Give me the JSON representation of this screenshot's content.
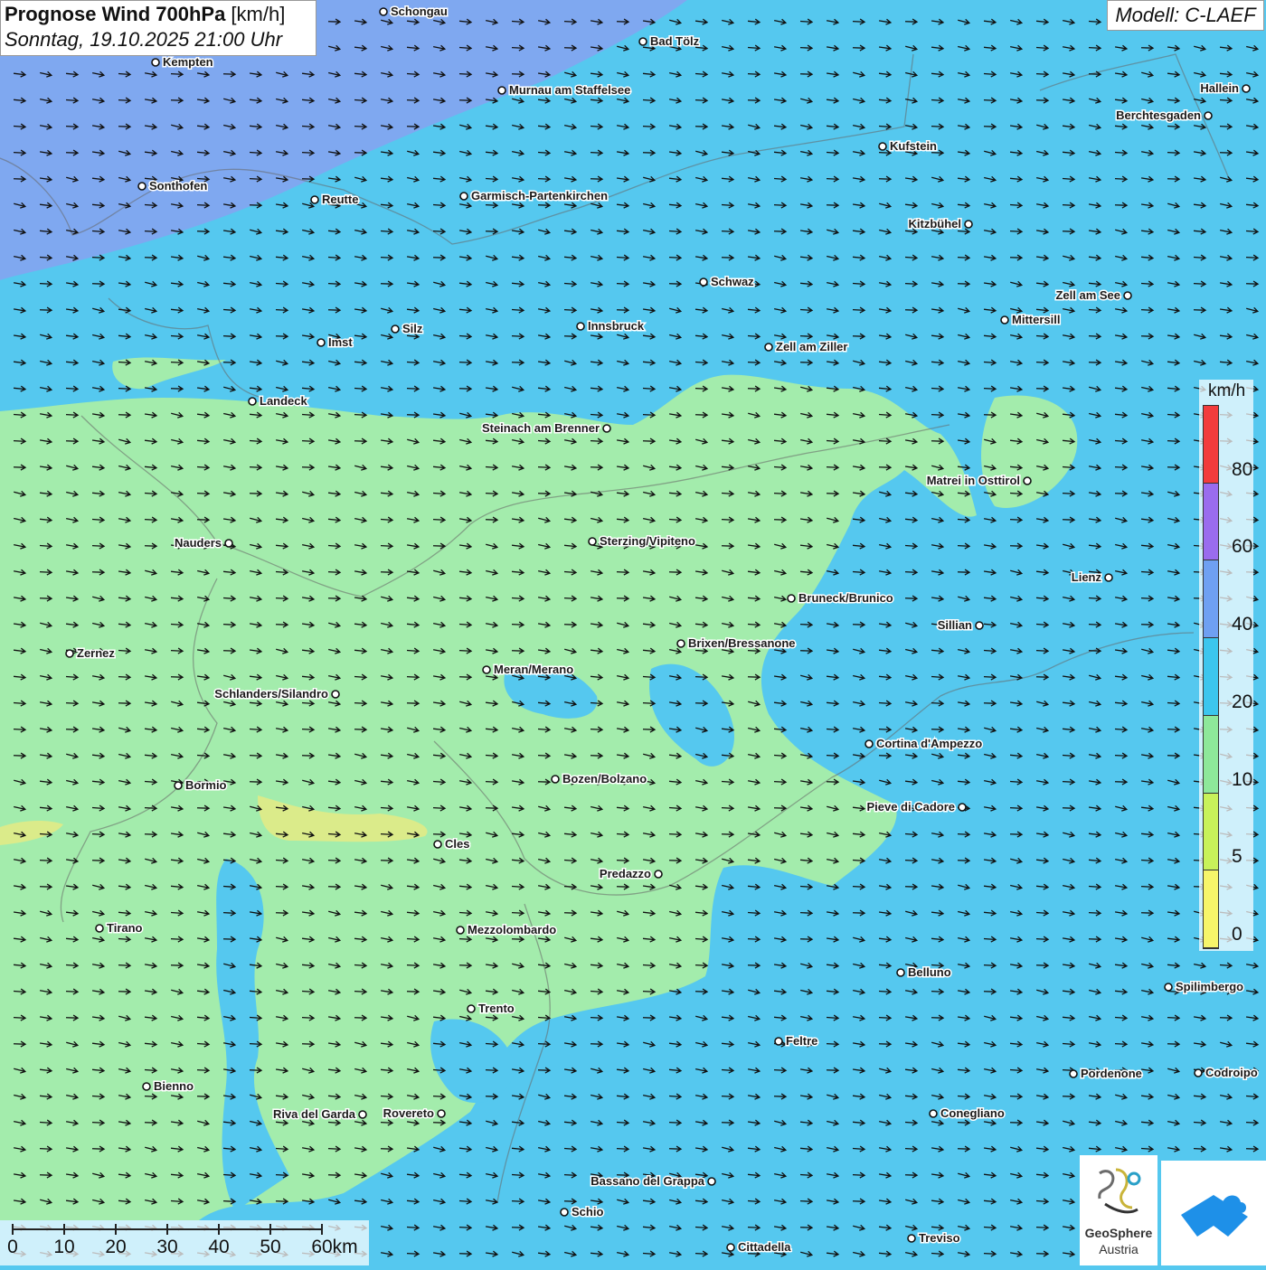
{
  "title": {
    "main_bold": "Prognose Wind 700hPa",
    "main_unit": " [km/h]",
    "subtitle": "Sonntag, 19.10.2025 21:00 Uhr"
  },
  "model_label": "Modell: C-LAEF",
  "legend": {
    "unit": "km/h",
    "ticks": [
      "0",
      "5",
      "10",
      "20",
      "40",
      "60",
      "80"
    ],
    "colors": [
      "#f7f56a",
      "#c8f25a",
      "#8ee89a",
      "#3cc6ee",
      "#6fa0f2",
      "#9a6cee",
      "#f23c3c"
    ]
  },
  "scalebar": {
    "labels": [
      "0",
      "10",
      "20",
      "30",
      "40",
      "50",
      "60km"
    ]
  },
  "logo": {
    "name": "GeoSphere",
    "sub": "Austria"
  },
  "colors": {
    "calm_green": "#a3ecac",
    "moderate_blue": "#55c8ef",
    "strong_blue": "#7fa8f0"
  },
  "cities": [
    {
      "name": "Schongau"
    },
    {
      "name": "Bad Tölz"
    },
    {
      "name": "Kempten"
    },
    {
      "name": "Murnau am Staffelsee"
    },
    {
      "name": "Hallein"
    },
    {
      "name": "Berchtesgaden"
    },
    {
      "name": "Kufstein"
    },
    {
      "name": "Sonthofen"
    },
    {
      "name": "Reutte"
    },
    {
      "name": "Garmisch-Partenkirchen"
    },
    {
      "name": "Kitzbühel"
    },
    {
      "name": "Schwaz"
    },
    {
      "name": "Zell am See"
    },
    {
      "name": "Innsbruck"
    },
    {
      "name": "Mittersill"
    },
    {
      "name": "Silz"
    },
    {
      "name": "Imst"
    },
    {
      "name": "Zell am Ziller"
    },
    {
      "name": "Landeck"
    },
    {
      "name": "Steinach am Brenner"
    },
    {
      "name": "Matrei in Osttirol"
    },
    {
      "name": "Nauders"
    },
    {
      "name": "Sterzing/Vipiteno"
    },
    {
      "name": "Lienz"
    },
    {
      "name": "Bruneck/Brunico"
    },
    {
      "name": "Sillian"
    },
    {
      "name": "Brixen/Bressanone"
    },
    {
      "name": "Zernez"
    },
    {
      "name": "Meran/Merano"
    },
    {
      "name": "Schlanders/Silandro"
    },
    {
      "name": "Cortina d'Ampezzo"
    },
    {
      "name": "Bozen/Bolzano"
    },
    {
      "name": "Bormio"
    },
    {
      "name": "Pieve di Cadore"
    },
    {
      "name": "Cles"
    },
    {
      "name": "Predazzo"
    },
    {
      "name": "Tirano"
    },
    {
      "name": "Mezzolombardo"
    },
    {
      "name": "Belluno"
    },
    {
      "name": "Spilimbergo"
    },
    {
      "name": "Trento"
    },
    {
      "name": "Feltre"
    },
    {
      "name": "Bienno"
    },
    {
      "name": "Pordenone"
    },
    {
      "name": "Codroipo"
    },
    {
      "name": "Riva del Garda"
    },
    {
      "name": "Rovereto"
    },
    {
      "name": "Conegliano"
    },
    {
      "name": "Bassano del Grappa"
    },
    {
      "name": "Schio"
    },
    {
      "name": "Treviso"
    },
    {
      "name": "Cittadella"
    }
  ]
}
